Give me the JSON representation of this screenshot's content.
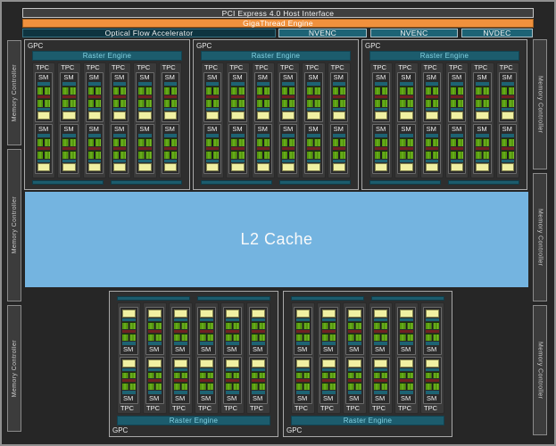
{
  "title_bars": {
    "pci_label": "PCI Express 4.0 Host Interface",
    "gigathread_label": "GigaThread Engine",
    "ofa_label": "Optical Flow Accelerator",
    "media_engines": [
      "NVENC",
      "NVENC",
      "NVDEC"
    ]
  },
  "l2_cache": {
    "label": "L2 Cache"
  },
  "memory_controllers": {
    "label": "Memory Controller",
    "left_count": 3,
    "right_count": 3
  },
  "gpu_clusters": {
    "gpc_label": "GPC",
    "raster_label": "Raster Engine",
    "tpc_label": "TPC",
    "sm_label": "SM",
    "top_row": {
      "gpc_count": 3,
      "tpcs_per_gpc": 6,
      "sms_per_tpc": 2,
      "orientation": "normal"
    },
    "bottom_row": {
      "gpc_count": 2,
      "tpcs_per_gpc": 6,
      "sms_per_tpc": 2,
      "orientation": "mirrored"
    }
  },
  "colors": {
    "background": "#262626",
    "outer_border": "#8f8f8f",
    "gigathread_orange": "#f0913d",
    "media_teal": "#1d6375",
    "ofa_dark_teal": "#0e3440",
    "raster_teal": "#1c5c6d",
    "raster_text": "#82d2e2",
    "sm_green": "#55990d",
    "sm_maroon": "#702121",
    "sm_yellow": "#f0f0a2",
    "l2_blue": "#74b4e0"
  }
}
